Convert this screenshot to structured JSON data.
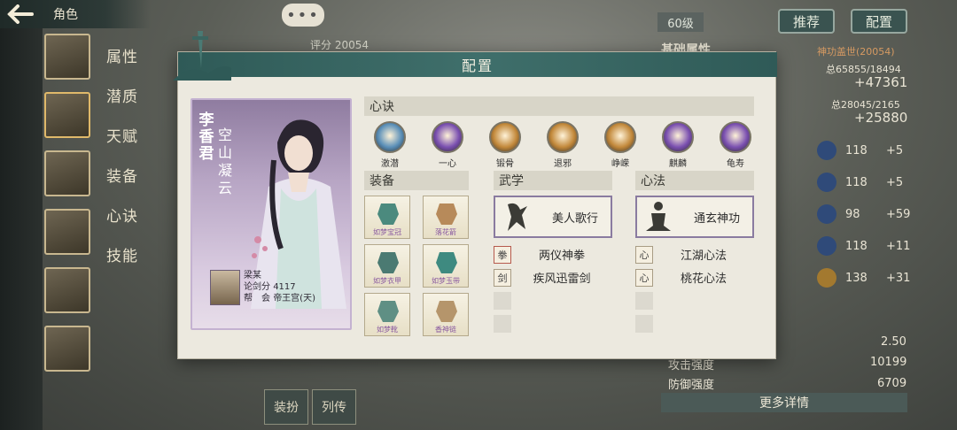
{
  "topbar": {
    "back_icon": "back-arrow-icon",
    "title": "角色"
  },
  "side_menu": [
    "属性",
    "潜质",
    "天赋",
    "装备",
    "心诀",
    "技能"
  ],
  "background": {
    "chat_dots": "•••",
    "level": "60级",
    "score_label": "评分 20054",
    "buttons": {
      "recommend": "推荐",
      "config": "配置"
    },
    "stats": {
      "base_title": "基础属性",
      "title_tag": "神功盖世(20054)",
      "total1": "总65855/18494",
      "total1_delta": "+47361",
      "total2": "总28045/2165",
      "total2_delta": "+25880",
      "rows": [
        {
          "value": "118",
          "delta": "+5"
        },
        {
          "value": "118",
          "delta": "+5"
        },
        {
          "value": "98",
          "delta": "+59"
        },
        {
          "value": "118",
          "delta": "+11"
        },
        {
          "value": "138",
          "delta": "+31"
        }
      ],
      "misc": [
        {
          "label": "",
          "value": "2.50"
        },
        {
          "label": "攻击强度",
          "value": "10199"
        },
        {
          "label": "防御强度",
          "value": "6709"
        }
      ],
      "more_details": "更多详情"
    },
    "bottom_tabs": [
      "装扮",
      "列传"
    ]
  },
  "modal": {
    "title": "配置",
    "character": {
      "name": "李香君",
      "title": "空山凝云",
      "owner": {
        "name": "梁某",
        "score_label": "论剑分",
        "score": "4117",
        "guild_label": "帮　会",
        "guild": "帝王宫(天)"
      }
    },
    "sections": {
      "xinjue": "心诀",
      "equipment": "装备",
      "wuxue": "武学",
      "xinfa": "心法"
    },
    "xinjue_items": [
      {
        "label": "激潜",
        "color": "#5a8fb8"
      },
      {
        "label": "一心",
        "color": "#7a4fb0"
      },
      {
        "label": "锻骨",
        "color": "#c2883a"
      },
      {
        "label": "退邪",
        "color": "#c2883a"
      },
      {
        "label": "峥嵘",
        "color": "#c2883a"
      },
      {
        "label": "麒麟",
        "color": "#7a4fb0"
      },
      {
        "label": "龟寿",
        "color": "#7a4fb0"
      }
    ],
    "equipment": [
      {
        "label": "如梦宝冠",
        "color": "#4b8a7e"
      },
      {
        "label": "落花箭",
        "color": "#b78a5a"
      },
      {
        "label": "如梦衣甲",
        "color": "#4b7a72"
      },
      {
        "label": "如梦玉带",
        "color": "#3e8a80"
      },
      {
        "label": "如梦靴",
        "color": "#5f8f84"
      },
      {
        "label": "香神链",
        "color": "#b5956b"
      }
    ],
    "wuxue": {
      "main": "美人歌行",
      "subs": [
        "两仪神拳",
        "疾风迅雷剑"
      ]
    },
    "xinfa": {
      "main": "通玄神功",
      "subs": [
        "江湖心法",
        "桃花心法"
      ]
    }
  }
}
